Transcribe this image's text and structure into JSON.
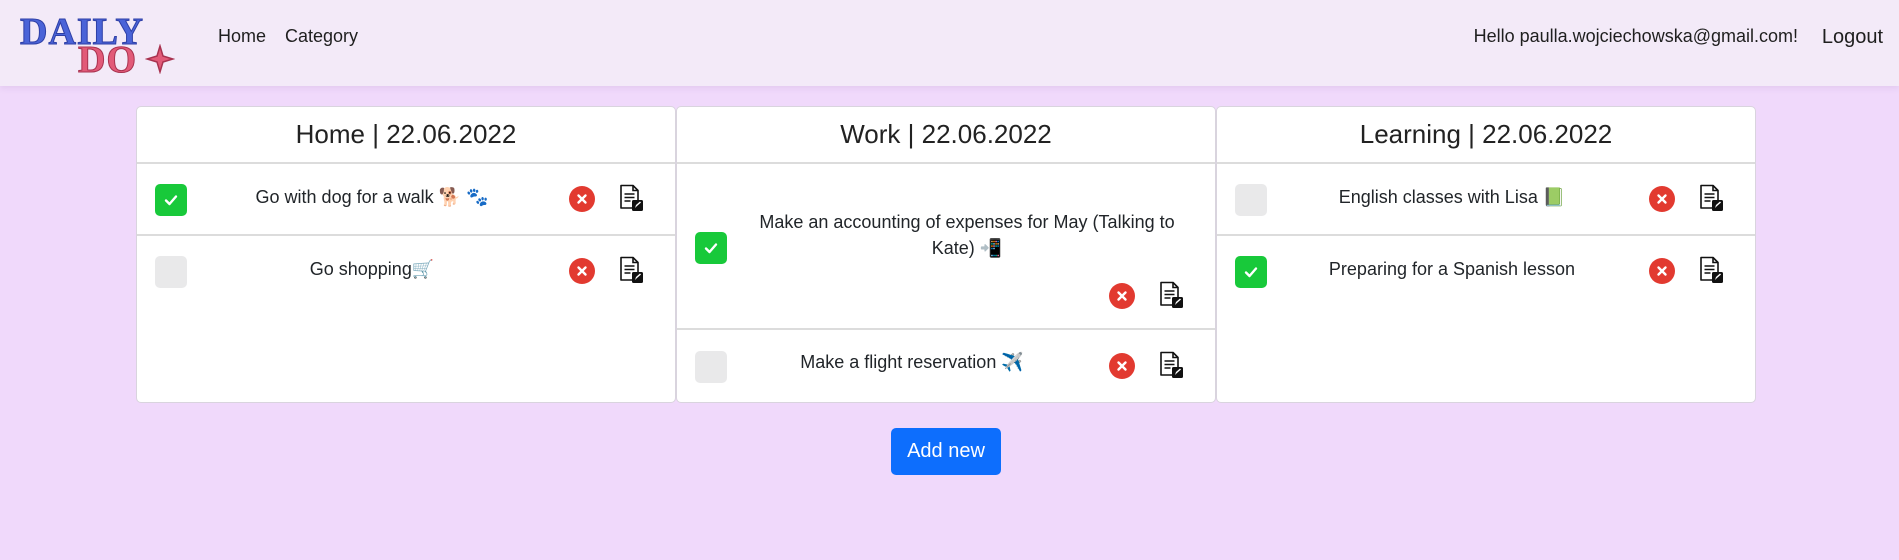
{
  "nav": {
    "logo_line1": "DAILY",
    "logo_line2": "DO",
    "home": "Home",
    "category": "Category",
    "greeting": "Hello paulla.wojciechowska@gmail.com!",
    "logout": "Logout"
  },
  "columns": [
    {
      "title": "Home | 22.06.2022",
      "tasks": [
        {
          "text": "Go with dog for a walk 🐕 🐾",
          "done": true
        },
        {
          "text": "Go shopping🛒",
          "done": false
        }
      ]
    },
    {
      "title": "Work | 22.06.2022",
      "tasks": [
        {
          "text": "Make an accounting of expenses for May (Talking to Kate) 📲",
          "done": true
        },
        {
          "text": "Make a flight reservation ✈️",
          "done": false
        }
      ]
    },
    {
      "title": "Learning | 22.06.2022",
      "tasks": [
        {
          "text": "English classes with Lisa 📗",
          "done": false
        },
        {
          "text": "Preparing for a Spanish lesson",
          "done": true
        }
      ]
    }
  ],
  "add_button": "Add new",
  "colors": {
    "background": "#f0d9fb",
    "navbar": "#f3eaf8",
    "done": "#18c93a",
    "delete": "#e23a30",
    "primary": "#0d6efd"
  },
  "icons": {
    "check": "check-icon",
    "delete": "close-circle-icon",
    "edit": "edit-document-icon",
    "logo_star": "star-icon"
  }
}
